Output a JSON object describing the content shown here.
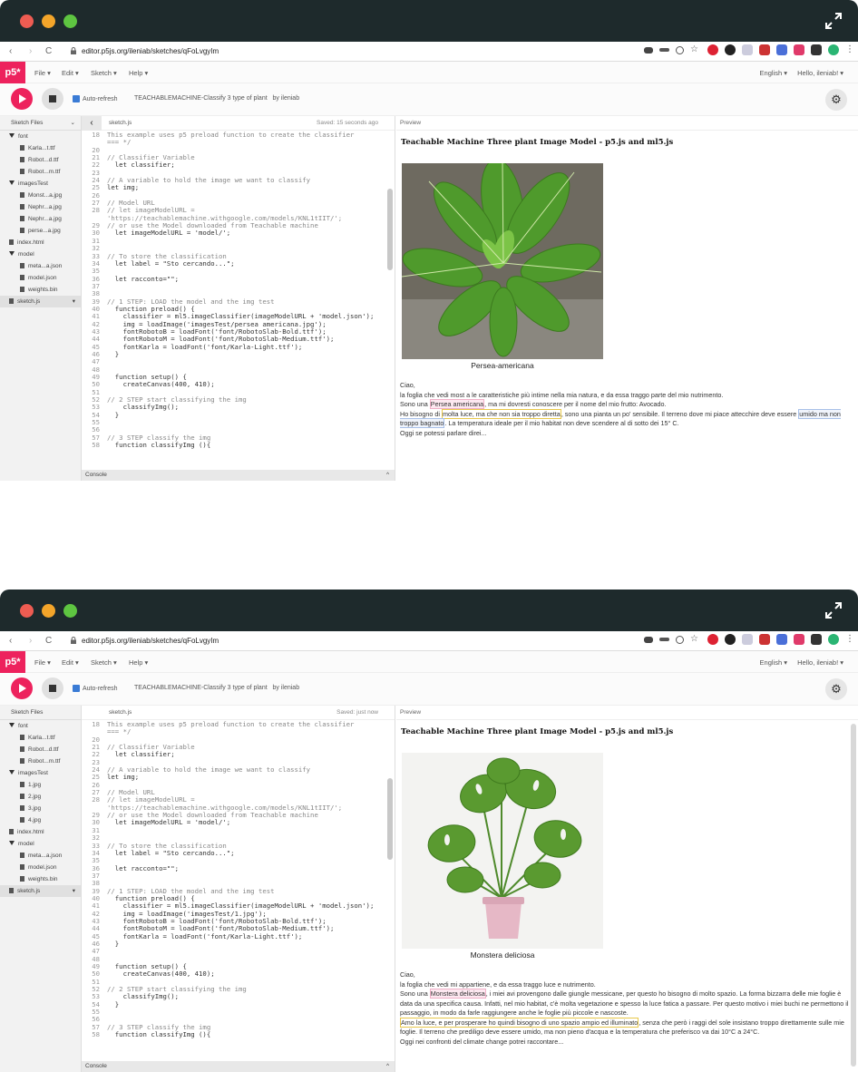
{
  "browser": {
    "url": "editor.p5js.org/ileniab/sketches/qFoLvgyIm",
    "nav_back": "‹",
    "nav_forward": "›",
    "nav_reload": "C"
  },
  "menubar": {
    "logo": "p5*",
    "file": "File ▾",
    "edit": "Edit ▾",
    "sketch": "Sketch ▾",
    "help": "Help ▾",
    "language": "English ▾",
    "user": "Hello, ileniab! ▾"
  },
  "toolbar": {
    "auto_refresh": "Auto-refresh",
    "sketch_name": "TEACHABLEMACHINE-Classify 3 type of plant",
    "by_user": "by ileniab"
  },
  "win1": {
    "files_header": "Sketch Files",
    "files": [
      {
        "name": "font",
        "type": "folder"
      },
      {
        "name": "Karla...t.ttf",
        "type": "file"
      },
      {
        "name": "Robot...d.ttf",
        "type": "file"
      },
      {
        "name": "Robot...m.ttf",
        "type": "file"
      },
      {
        "name": "imagesTest",
        "type": "folder"
      },
      {
        "name": "Monst...a.jpg",
        "type": "file"
      },
      {
        "name": "Nephr...a.jpg",
        "type": "file"
      },
      {
        "name": "Nephr...a.jpg",
        "type": "file"
      },
      {
        "name": "perse...a.jpg",
        "type": "file"
      },
      {
        "name": "index.html",
        "type": "rootfile"
      },
      {
        "name": "model",
        "type": "folder"
      },
      {
        "name": "meta...a.json",
        "type": "file"
      },
      {
        "name": "model.json",
        "type": "file"
      },
      {
        "name": "weights.bin",
        "type": "file"
      },
      {
        "name": "sketch.js",
        "type": "rootfile-selected"
      }
    ],
    "editor_file": "sketch.js",
    "saved": "Saved: 15 seconds ago",
    "console": "Console",
    "preview_label": "Preview",
    "preview_title": "Teachable Machine Three plant Image Model - p5.js and ml5.js",
    "caption": "Persea-americana",
    "text": [
      "Ciao,",
      "la foglia che vedi most a le caratteristiche più intime nella mia natura, e da essa traggo parte del mio nutrimento.",
      "Sono una ",
      "Persea americana",
      ", ma mi dovresti conoscere per il nome del mio frutto: Avocado.",
      "Ho bisogno di ",
      "molta luce, ma che non sia troppo diretta",
      ", sono una pianta un po' sensibile. Il terreno dove mi piace attecchire deve essere ",
      "umido ma non troppo bagnato",
      ". La temperatura ideale per il mio habitat non deve scendere al di sotto dei 15° C.",
      "Oggi se potessi parlare direi..."
    ]
  },
  "win2": {
    "files_header": "Sketch Files",
    "files": [
      {
        "name": "font",
        "type": "folder"
      },
      {
        "name": "Karla...t.ttf",
        "type": "file"
      },
      {
        "name": "Robot...d.ttf",
        "type": "file"
      },
      {
        "name": "Robot...m.ttf",
        "type": "file"
      },
      {
        "name": "imagesTest",
        "type": "folder"
      },
      {
        "name": "1.jpg",
        "type": "file"
      },
      {
        "name": "2.jpg",
        "type": "file"
      },
      {
        "name": "3.jpg",
        "type": "file"
      },
      {
        "name": "4.jpg",
        "type": "file"
      },
      {
        "name": "index.html",
        "type": "rootfile"
      },
      {
        "name": "model",
        "type": "folder"
      },
      {
        "name": "meta...a.json",
        "type": "file"
      },
      {
        "name": "model.json",
        "type": "file"
      },
      {
        "name": "weights.bin",
        "type": "file"
      },
      {
        "name": "sketch.js",
        "type": "rootfile-selected"
      }
    ],
    "editor_file": "sketch.js",
    "saved": "Saved: just now",
    "console": "Console",
    "preview_label": "Preview",
    "preview_title": "Teachable Machine Three plant Image Model - p5.js and ml5.js",
    "caption": "Monstera deliciosa",
    "text": [
      "Ciao,",
      "la foglia che vedi mi appartiene, e da essa traggo luce e nutrimento.",
      "Sono una ",
      "Monstera deliciosa",
      ", i miei avi provengono dalle giungle messicane, per questo ho bisogno di molto spazio. La forma bizzarra delle mie foglie è data da una specifica causa. Infatti, nel mio habitat, c'è molta vegetazione e spesso la luce fatica a passare. Per questo motivo i miei buchi ne permettono il passaggio, in modo da farle raggiungere anche le foglie più piccole e nascoste.",
      "Amo la luce, e per prosperare ho quindi bisogno di uno spazio ampio ed illuminato",
      ", senza che però i raggi del sole insistano troppo direttamente sulle mie foglie. Il terreno che prediligo deve essere umido, ma non pieno d'acqua e la temperatura che preferisco va dai 10°C a 24°C.",
      "Oggi nei confronti del climate change potrei raccontare..."
    ]
  },
  "code1": [
    [
      "18",
      "This example uses p5 preload function to create the classifier"
    ],
    [
      "",
      "=== */"
    ],
    [
      "20",
      ""
    ],
    [
      "21",
      "// Classifier Variable"
    ],
    [
      "22",
      "  let classifier;"
    ],
    [
      "23",
      ""
    ],
    [
      "24",
      "// A variable to hold the image we want to classify"
    ],
    [
      "25",
      "let img;"
    ],
    [
      "26",
      ""
    ],
    [
      "27",
      "// Model URL"
    ],
    [
      "28",
      "// let imageModelURL ="
    ],
    [
      "",
      "'https://teachablemachine.withgoogle.com/models/KNL1tIIT/';"
    ],
    [
      "29",
      "// or use the Model downloaded from Teachable machine"
    ],
    [
      "30",
      "  let imageModelURL = 'model/';"
    ],
    [
      "31",
      ""
    ],
    [
      "32",
      ""
    ],
    [
      "33",
      "// To store the classification"
    ],
    [
      "34",
      "  let label = \"Sto cercando...\";"
    ],
    [
      "35",
      ""
    ],
    [
      "36",
      "  let racconto=\"\";"
    ],
    [
      "37",
      ""
    ],
    [
      "38",
      ""
    ],
    [
      "39",
      "// 1 STEP: LOAD the model and the img test"
    ],
    [
      "40",
      "  function preload() {"
    ],
    [
      "41",
      "    classifier = ml5.imageClassifier(imageModelURL + 'model.json');"
    ],
    [
      "42",
      "    img = loadImage('imagesTest/persea americana.jpg');"
    ],
    [
      "43",
      "    fontRobotoB = loadFont('font/RobotoSlab-Bold.ttf');"
    ],
    [
      "44",
      "    fontRobotoM = loadFont('font/RobotoSlab-Medium.ttf');"
    ],
    [
      "45",
      "    fontKarla = loadFont('font/Karla-Light.ttf');"
    ],
    [
      "46",
      "  }"
    ],
    [
      "47",
      ""
    ],
    [
      "48",
      ""
    ],
    [
      "49",
      "  function setup() {"
    ],
    [
      "50",
      "    createCanvas(400, 410);"
    ],
    [
      "51",
      ""
    ],
    [
      "52",
      "// 2 STEP start classifying the img"
    ],
    [
      "53",
      "    classifyImg();"
    ],
    [
      "54",
      "  }"
    ],
    [
      "55",
      ""
    ],
    [
      "56",
      ""
    ],
    [
      "57",
      "// 3 STEP classify the img"
    ],
    [
      "58",
      "  function classifyImg (){"
    ]
  ],
  "code2": [
    [
      "18",
      "This example uses p5 preload function to create the classifier"
    ],
    [
      "",
      "=== */"
    ],
    [
      "20",
      ""
    ],
    [
      "21",
      "// Classifier Variable"
    ],
    [
      "22",
      "  let classifier;"
    ],
    [
      "23",
      ""
    ],
    [
      "24",
      "// A variable to hold the image we want to classify"
    ],
    [
      "25",
      "let img;"
    ],
    [
      "26",
      ""
    ],
    [
      "27",
      "// Model URL"
    ],
    [
      "28",
      "// let imageModelURL ="
    ],
    [
      "",
      "'https://teachablemachine.withgoogle.com/models/KNL1tIIT/';"
    ],
    [
      "29",
      "// or use the Model downloaded from Teachable machine"
    ],
    [
      "30",
      "  let imageModelURL = 'model/';"
    ],
    [
      "31",
      ""
    ],
    [
      "32",
      ""
    ],
    [
      "33",
      "// To store the classification"
    ],
    [
      "34",
      "  let label = \"Sto cercando...\";"
    ],
    [
      "35",
      ""
    ],
    [
      "36",
      "  let racconto=\"\";"
    ],
    [
      "37",
      ""
    ],
    [
      "38",
      ""
    ],
    [
      "39",
      "// 1 STEP: LOAD the model and the img test"
    ],
    [
      "40",
      "  function preload() {"
    ],
    [
      "41",
      "    classifier = ml5.imageClassifier(imageModelURL + 'model.json');"
    ],
    [
      "42",
      "    img = loadImage('imagesTest/1.jpg');"
    ],
    [
      "43",
      "    fontRobotoB = loadFont('font/RobotoSlab-Bold.ttf');"
    ],
    [
      "44",
      "    fontRobotoM = loadFont('font/RobotoSlab-Medium.ttf');"
    ],
    [
      "45",
      "    fontKarla = loadFont('font/Karla-Light.ttf');"
    ],
    [
      "46",
      "  }"
    ],
    [
      "47",
      ""
    ],
    [
      "48",
      ""
    ],
    [
      "49",
      "  function setup() {"
    ],
    [
      "50",
      "    createCanvas(400, 410);"
    ],
    [
      "51",
      ""
    ],
    [
      "52",
      "// 2 STEP start classifying the img"
    ],
    [
      "53",
      "    classifyImg();"
    ],
    [
      "54",
      "  }"
    ],
    [
      "55",
      ""
    ],
    [
      "56",
      ""
    ],
    [
      "57",
      "// 3 STEP classify the img"
    ],
    [
      "58",
      "  function classifyImg (){"
    ]
  ],
  "colors": {
    "p5_pink": "#ed225d",
    "titlebar": "#1e2a2c",
    "leaf_green": "#5fa83a"
  }
}
